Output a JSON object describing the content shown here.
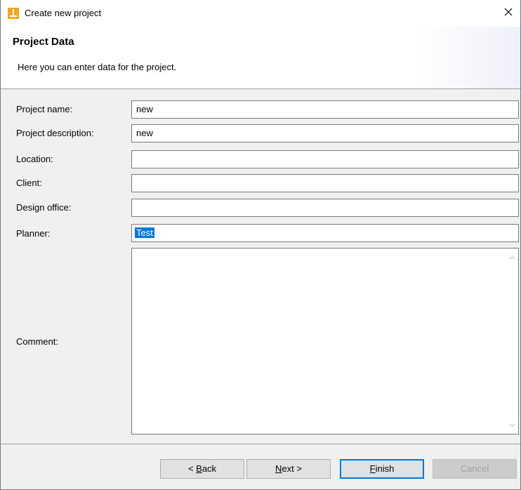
{
  "window": {
    "title": "Create new project"
  },
  "header": {
    "title": "Project Data",
    "subtitle": "Here you can enter data for the project."
  },
  "form": {
    "project_name": {
      "label": "Project name:",
      "value": "new"
    },
    "project_description": {
      "label": "Project description:",
      "value": "new"
    },
    "location": {
      "label": "Location:",
      "value": ""
    },
    "client": {
      "label": "Client:",
      "value": ""
    },
    "design_office": {
      "label": "Design office:",
      "value": ""
    },
    "planner": {
      "label": "Planner:",
      "value": "Test"
    },
    "comment": {
      "label": "Comment:",
      "value": ""
    }
  },
  "buttons": {
    "back": {
      "mnemonic": "B",
      "rest": "ack",
      "prefix": "< "
    },
    "next": {
      "mnemonic": "N",
      "rest": "ext >"
    },
    "finish": {
      "mnemonic": "F",
      "rest": "inish"
    },
    "cancel": {
      "label": "Cancel"
    }
  },
  "colors": {
    "accent": "#0078d7",
    "icon": "#f7a51c"
  },
  "icons": {
    "app": "app-icon",
    "close": "close-icon",
    "scroll_up": "chevron-up-icon",
    "scroll_down": "chevron-down-icon"
  }
}
